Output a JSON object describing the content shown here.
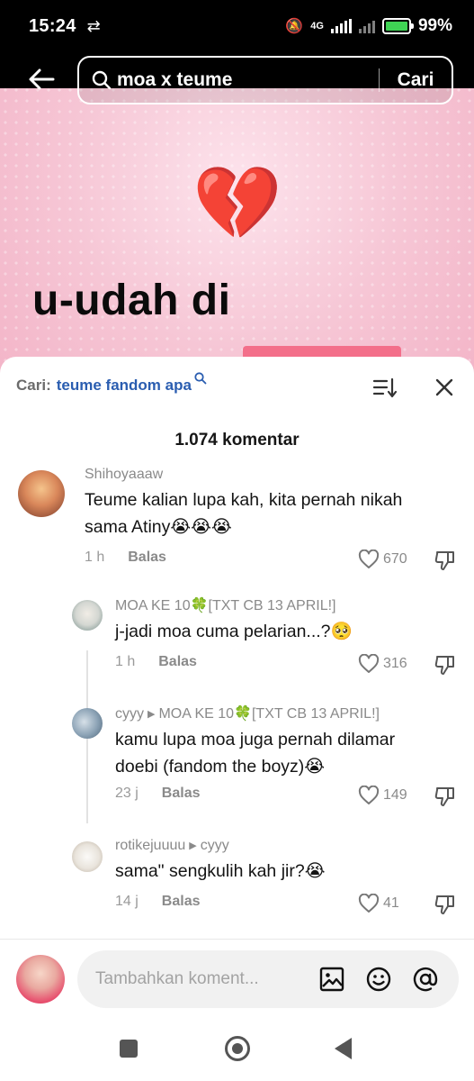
{
  "status_bar": {
    "time": "15:24",
    "sync_icon": "sync-icon",
    "network": "4G",
    "battery_percent": "99%",
    "battery_level": 0.99
  },
  "video": {
    "emoji": "💔",
    "caption": "u-udah di"
  },
  "search": {
    "query": "moa x teume",
    "submit_label": "Cari"
  },
  "comments_sheet": {
    "search_label": "Cari:",
    "search_term": "teume fandom apa",
    "count_label": "1.074 komentar",
    "comments": [
      {
        "user": "Shihoyaaaw",
        "text": "Teume kalian lupa kah, kita pernah nikah sama Atiny😭😭😭",
        "time": "1 h",
        "reply_label": "Balas",
        "likes": "670"
      },
      {
        "user": "MOA KE 10🍀[TXT CB 13 APRIL!]",
        "text": "j-jadi moa cuma pelarian...?🥺",
        "time": "1 h",
        "reply_label": "Balas",
        "likes": "316"
      },
      {
        "user": "cyyy",
        "reply_to": "MOA KE 10🍀[TXT CB 13 APRIL!]",
        "text": "kamu lupa moa juga pernah dilamar doebi (fandom the boyz)😭",
        "time": "23 j",
        "reply_label": "Balas",
        "likes": "149"
      },
      {
        "user": "rotikejuuuu",
        "reply_to": "cyyy",
        "text": "sama\" sengkulih kah jir?😭",
        "time": "14 j",
        "reply_label": "Balas",
        "likes": "41"
      }
    ]
  },
  "comment_input": {
    "placeholder": "Tambahkan koment..."
  },
  "colors": {
    "accent_link": "#2a5db0",
    "battery_green": "#3fd454",
    "caption_highlight": "#f36f8a"
  }
}
